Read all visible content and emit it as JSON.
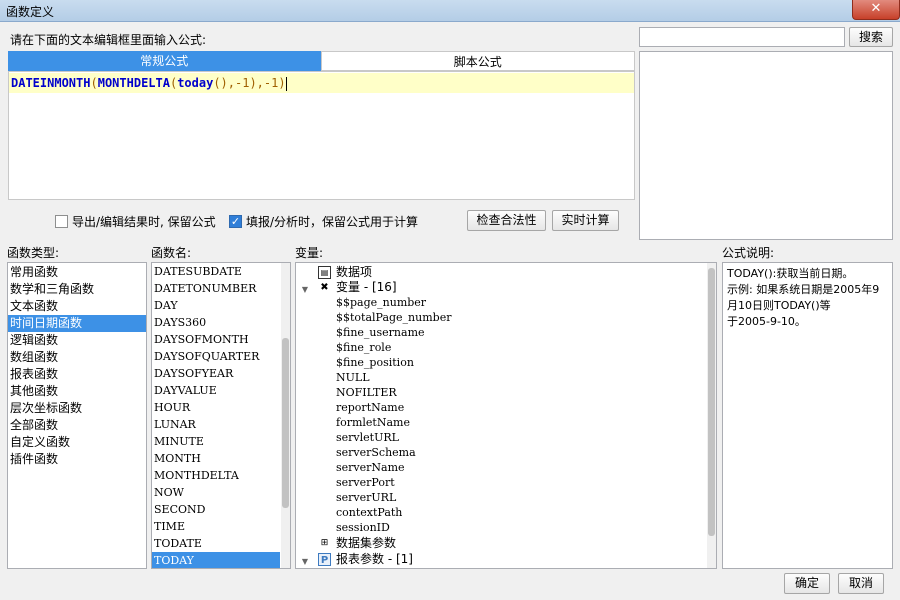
{
  "window": {
    "title": "函数定义",
    "close_label": "✕"
  },
  "prompt": "请在下面的文本编辑框里面输入公式:",
  "search": {
    "value": "",
    "button_label": "搜索"
  },
  "tabs": [
    {
      "label": "常规公式",
      "active": true
    },
    {
      "label": "脚本公式",
      "active": false
    }
  ],
  "formula": {
    "parts": [
      "DATEINMONTH",
      "(",
      "MONTHDELTA",
      "(",
      "today",
      "(),-1),-1)"
    ]
  },
  "options": {
    "keep_formula_export": {
      "label": "导出/编辑结果时, 保留公式",
      "checked": false
    },
    "keep_formula_fill": {
      "label": "填报/分析时，保留公式用于计算",
      "checked": true
    }
  },
  "buttons": {
    "check": "检查合法性",
    "realtime": "实时计算",
    "ok": "确定",
    "cancel": "取消"
  },
  "headers": {
    "category": "函数类型:",
    "function": "函数名:",
    "variable": "变量:",
    "description": "公式说明:"
  },
  "categories": [
    "常用函数",
    "数学和三角函数",
    "文本函数",
    "时间日期函数",
    "逻辑函数",
    "数组函数",
    "报表函数",
    "其他函数",
    "层次坐标函数",
    "全部函数",
    "自定义函数",
    "插件函数"
  ],
  "selected_category": 3,
  "functions": [
    "DATESUBDATE",
    "DATETONUMBER",
    "DAY",
    "DAYS360",
    "DAYSOFMONTH",
    "DAYSOFQUARTER",
    "DAYSOFYEAR",
    "DAYVALUE",
    "HOUR",
    "LUNAR",
    "MINUTE",
    "MONTH",
    "MONTHDELTA",
    "NOW",
    "SECOND",
    "TIME",
    "TODATE",
    "TODAY"
  ],
  "selected_function": 17,
  "variables": {
    "data_item": "数据项",
    "var_group": "变量 - [16]",
    "vars": [
      "$$page_number",
      "$$totalPage_number",
      "$fine_username",
      "$fine_role",
      "$fine_position",
      "NULL",
      "NOFILTER",
      "reportName",
      "formletName",
      "servletURL",
      "serverSchema",
      "serverName",
      "serverPort",
      "serverURL",
      "contextPath",
      "sessionID"
    ],
    "dataset_params": "数据集参数",
    "report_params": "报表参数 - [1]"
  },
  "description": "TODAY():获取当前日期。\n示例: 如果系统日期是2005年9\n月10日则TODAY()等\n于2005-9-10。"
}
